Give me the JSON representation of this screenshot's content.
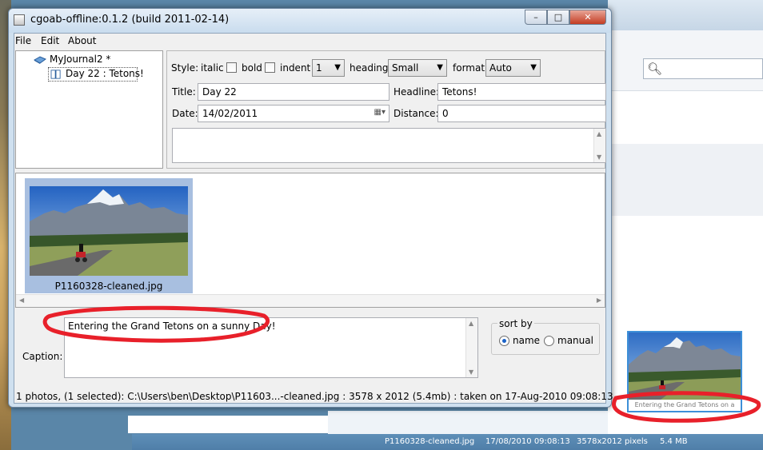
{
  "window": {
    "title": "cgoab-offline:0.1.2 (build 2011-02-14)",
    "controls": {
      "minimize": "–",
      "maximize": "□",
      "close": "✕"
    }
  },
  "menu": {
    "file": "File",
    "edit": "Edit",
    "about": "About"
  },
  "tree": {
    "root": "MyJournal2 *",
    "child": "Day 22 : Tetons!"
  },
  "style_row": {
    "style_label": "Style:",
    "italic_label": "italic",
    "bold_label": "bold",
    "indent_label": "indent",
    "indent_value": "1",
    "heading_label": "heading",
    "heading_value": "Small",
    "format_label": "format",
    "format_value": "Auto"
  },
  "fields": {
    "title_label": "Title:",
    "title_value": "Day 22",
    "headline_label": "Headline:",
    "headline_value": "Tetons!",
    "date_label": "Date:",
    "date_value": "14/02/2011",
    "distance_label": "Distance:",
    "distance_value": "0"
  },
  "photo": {
    "filename": "P1160328-cleaned.jpg"
  },
  "caption": {
    "label": "Caption:",
    "value": "Entering the Grand Tetons on a sunny Day!"
  },
  "sort": {
    "title": "sort by",
    "name_label": "name",
    "manual_label": "manual",
    "selected": "name"
  },
  "status": "1 photos, (1 selected): C:\\Users\\ben\\Desktop\\P11603...-cleaned.jpg : 3578 x 2012 (5.4mb)  : taken on 17-Aug-2010 09:08:13",
  "background_app": {
    "thumbnail_caption": "Entering the Grand Tetons on a",
    "detail_filename": "P1160328-cleaned.jpg",
    "detail_date": "17/08/2010 09:08:13",
    "detail_dims": "3578x2012 pixels",
    "detail_size": "5.4 MB"
  },
  "colors": {
    "annotation": "#e8202a",
    "selection": "#a8bfe0",
    "statusstrip": "#4f7ea8"
  }
}
